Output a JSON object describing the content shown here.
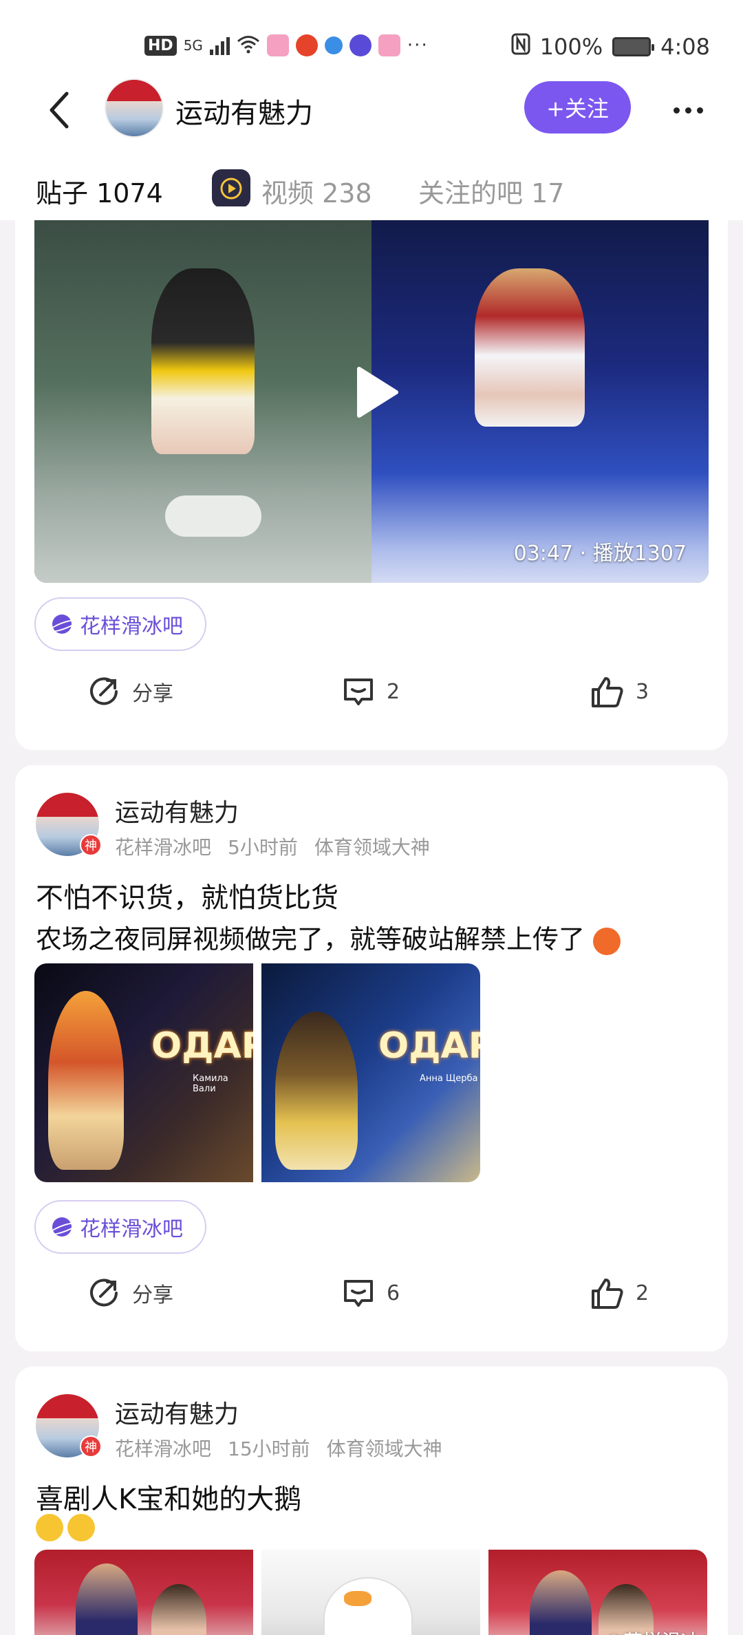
{
  "status_bar": {
    "hd": "HD",
    "network": "5G",
    "apps": [
      "bilibili",
      "weibo",
      "qq-browser",
      "tieba",
      "bilibili"
    ],
    "more": "···",
    "battery": "100%",
    "time": "4:08"
  },
  "header": {
    "title": "运动有魅力",
    "follow_label": "+关注"
  },
  "tabs": [
    {
      "label": "贴子 1074"
    },
    {
      "label": "视频 238"
    },
    {
      "label": "关注的吧 17"
    }
  ],
  "posts": [
    {
      "video_meta": "03:47 · 播放1307",
      "bar": "花样滑冰吧",
      "share": "分享",
      "comments": "2",
      "likes": "3"
    },
    {
      "author": "运动有魅力",
      "badge": "神",
      "bar_name": "花样滑冰吧",
      "time": "5小时前",
      "title_rank": "体育领域大神",
      "title": "不怕不识货，就怕货比货",
      "body": "农场之夜同屏视频做完了，就等破站解禁上传了",
      "image_texts": [
        {
          "word": "ОДАР",
          "sub": "Камила Вали"
        },
        {
          "word": "ОДАР",
          "sub": "Анна Щерба"
        }
      ],
      "bar": "花样滑冰吧",
      "share": "分享",
      "comments": "6",
      "likes": "2"
    },
    {
      "author": "运动有魅力",
      "badge": "神",
      "bar_name": "花样滑冰吧",
      "time": "15小时前",
      "title_rank": "体育领域大神",
      "title": "喜剧人K宝和她的大鹅",
      "watermark": "@花样滑冰"
    }
  ],
  "colors": {
    "accent": "#7b57f0",
    "badge_red": "#e83a3a",
    "tag_text": "#6a4ed8"
  }
}
